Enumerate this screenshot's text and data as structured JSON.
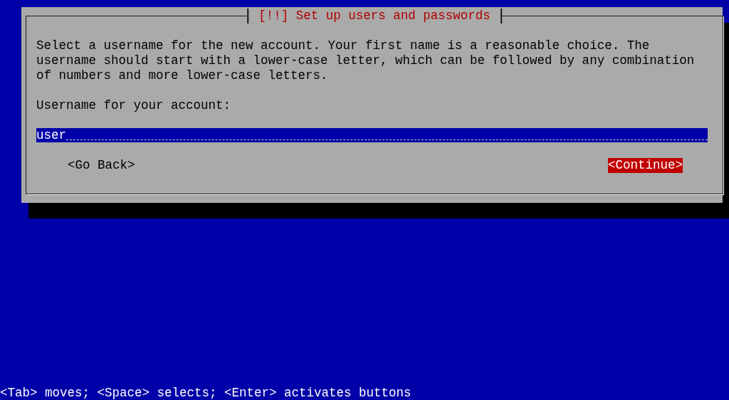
{
  "dialog": {
    "title": "[!!] Set up users and passwords",
    "description": "Select a username for the new account. Your first name is a reasonable choice. The username should start with a lower-case letter, which can be followed by any combination of numbers and more lower-case letters.",
    "field_label": "Username for your account:",
    "field": {
      "value": "user"
    },
    "buttons": [
      {
        "label": "<Go Back>",
        "selected": false
      },
      {
        "label": "<Continue>",
        "selected": true
      }
    ]
  },
  "help_line": "<Tab> moves; <Space> selects; <Enter> activates buttons"
}
